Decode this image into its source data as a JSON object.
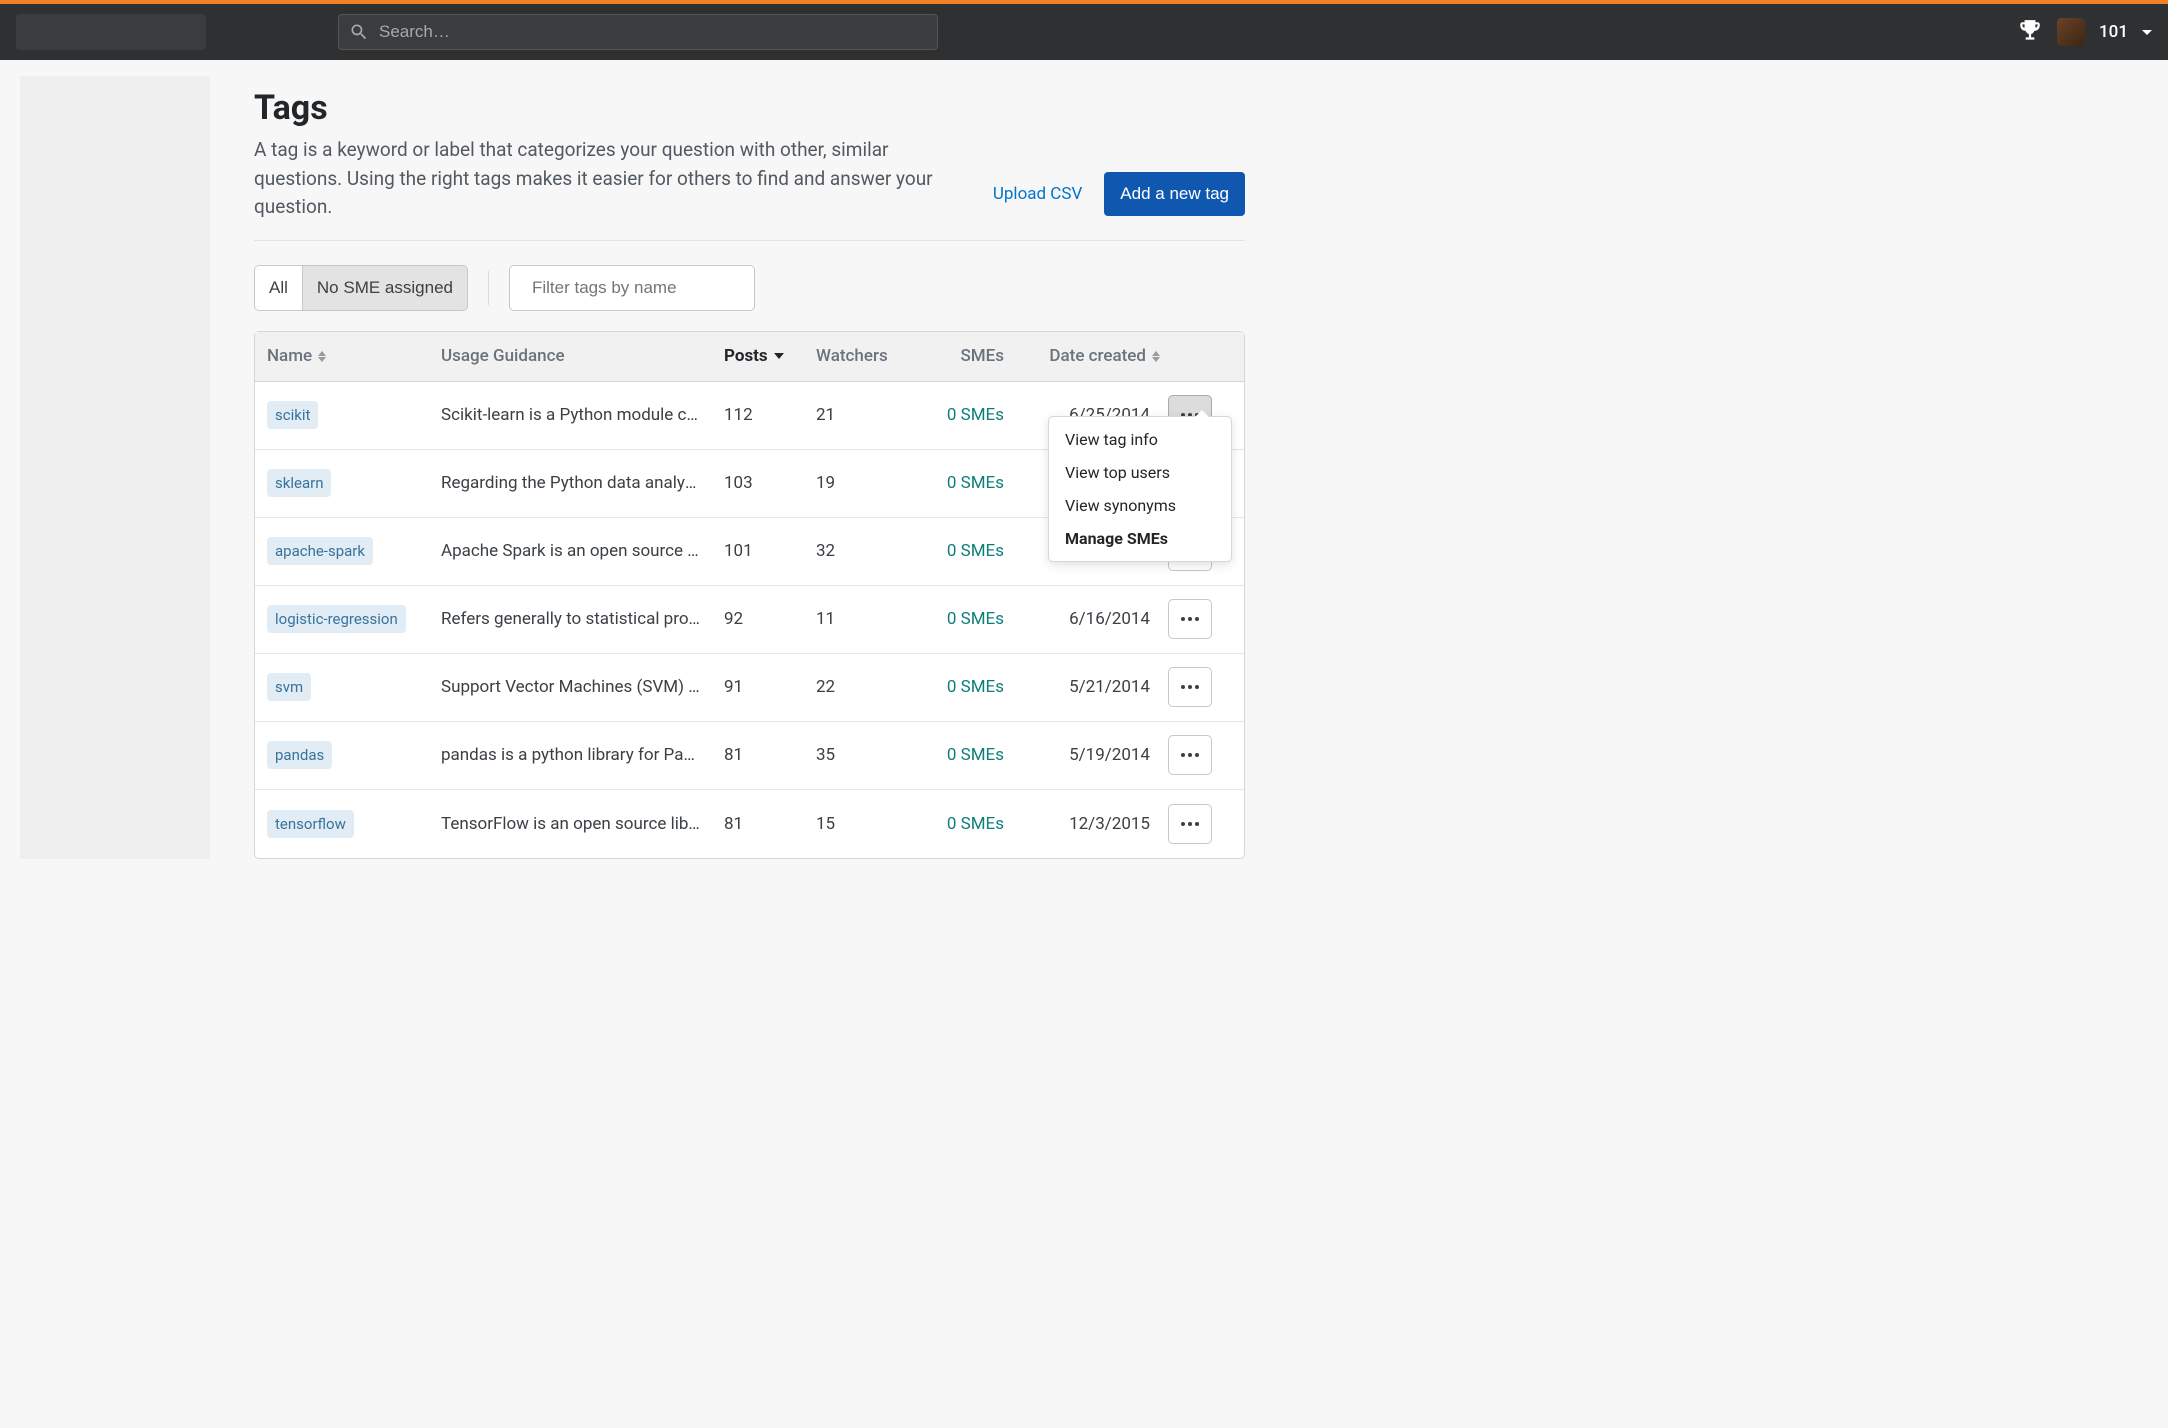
{
  "topbar": {
    "search_placeholder": "Search…",
    "reputation": "101"
  },
  "page": {
    "title": "Tags",
    "description": "A tag is a keyword or label that categorizes your question with other, similar questions. Using the right tags makes it easier for others to find and answer your question.",
    "upload_csv": "Upload CSV",
    "add_tag": "Add a new tag"
  },
  "toolbar": {
    "seg_all": "All",
    "seg_no_sme": "No SME assigned",
    "filter_placeholder": "Filter tags by name"
  },
  "columns": {
    "name": "Name",
    "usage": "Usage Guidance",
    "posts": "Posts",
    "watchers": "Watchers",
    "smes": "SMEs",
    "date": "Date created"
  },
  "rows": [
    {
      "tag": "scikit",
      "usage": "Scikit-learn is a Python module co…",
      "posts": "112",
      "watchers": "21",
      "smes": "0 SMEs",
      "date": "6/25/2014"
    },
    {
      "tag": "sklearn",
      "usage": "Regarding the Python data analysi…",
      "posts": "103",
      "watchers": "19",
      "smes": "0 SMEs",
      "date": ""
    },
    {
      "tag": "apache-spark",
      "usage": "Apache Spark is an open source c…",
      "posts": "101",
      "watchers": "32",
      "smes": "0 SMEs",
      "date": ""
    },
    {
      "tag": "logistic-regression",
      "usage": "Refers generally to statistical proc…",
      "posts": "92",
      "watchers": "11",
      "smes": "0 SMEs",
      "date": "6/16/2014"
    },
    {
      "tag": "svm",
      "usage": "Support Vector Machines (SVM) a…",
      "posts": "91",
      "watchers": "22",
      "smes": "0 SMEs",
      "date": "5/21/2014"
    },
    {
      "tag": "pandas",
      "usage": "pandas is a python library for Pan…",
      "posts": "81",
      "watchers": "35",
      "smes": "0 SMEs",
      "date": "5/19/2014"
    },
    {
      "tag": "tensorflow",
      "usage": "TensorFlow is an open source libr…",
      "posts": "81",
      "watchers": "15",
      "smes": "0 SMEs",
      "date": "12/3/2015"
    }
  ],
  "popover": {
    "view_info": "View tag info",
    "view_top": "View top users",
    "view_syn": "View synonyms",
    "manage": "Manage SMEs"
  }
}
